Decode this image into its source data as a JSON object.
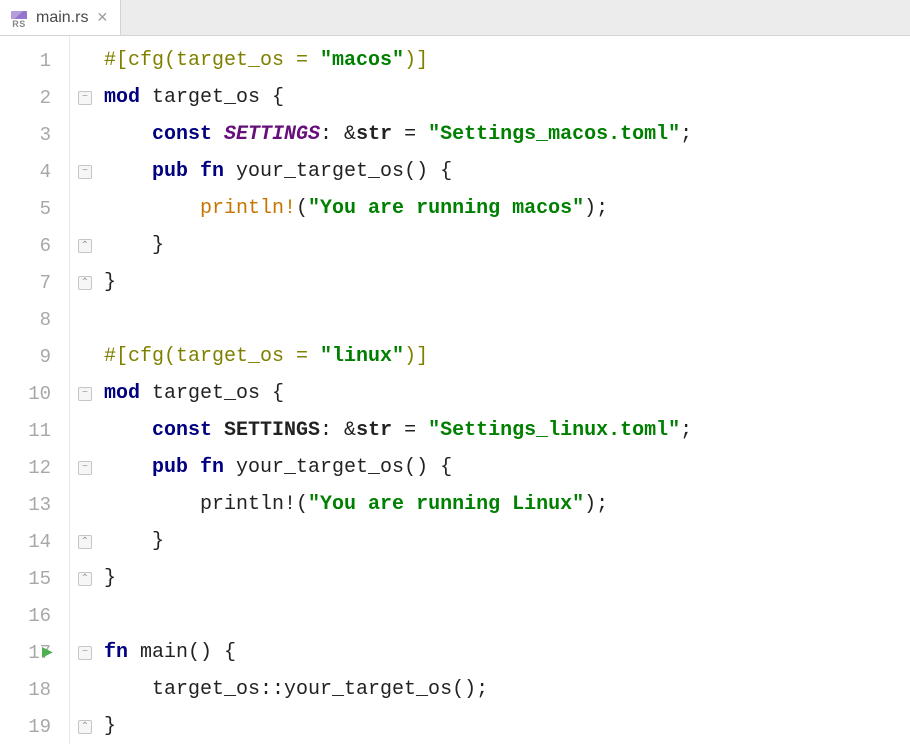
{
  "tab": {
    "filename": "main.rs",
    "icon_text": "RS"
  },
  "gutter": {
    "run_line": 17
  },
  "lines": [
    {
      "n": 1,
      "fold": "",
      "tokens": [
        [
          "attr",
          "#[cfg(target_os = "
        ],
        [
          "str",
          "\"macos\""
        ],
        [
          "attr",
          ")]"
        ]
      ],
      "indent": 0
    },
    {
      "n": 2,
      "fold": "open",
      "tokens": [
        [
          "kw",
          "mod "
        ],
        [
          "ident",
          "target_os "
        ],
        [
          "punct",
          "{"
        ]
      ],
      "indent": 0
    },
    {
      "n": 3,
      "fold": "",
      "tokens": [
        [
          "kw",
          "const "
        ],
        [
          "const_i",
          "SETTINGS"
        ],
        [
          "punct",
          ": &"
        ],
        [
          "type",
          "str"
        ],
        [
          "punct",
          " = "
        ],
        [
          "str",
          "\"Settings_macos.toml\""
        ],
        [
          "punct",
          ";"
        ]
      ],
      "indent": 1
    },
    {
      "n": 4,
      "fold": "open",
      "tokens": [
        [
          "kw",
          "pub fn "
        ],
        [
          "fn",
          "your_target_os"
        ],
        [
          "punct",
          "() {"
        ]
      ],
      "indent": 1
    },
    {
      "n": 5,
      "fold": "",
      "tokens": [
        [
          "macro",
          "println!"
        ],
        [
          "punct",
          "("
        ],
        [
          "str",
          "\"You are running macos\""
        ],
        [
          "punct",
          ");"
        ]
      ],
      "indent": 2
    },
    {
      "n": 6,
      "fold": "close",
      "tokens": [
        [
          "punct",
          "}"
        ]
      ],
      "indent": 1
    },
    {
      "n": 7,
      "fold": "close",
      "tokens": [
        [
          "punct",
          "}"
        ]
      ],
      "indent": 0
    },
    {
      "n": 8,
      "fold": "",
      "tokens": [],
      "indent": 0
    },
    {
      "n": 9,
      "fold": "",
      "tokens": [
        [
          "attr",
          "#[cfg(target_os = "
        ],
        [
          "str",
          "\"linux\""
        ],
        [
          "attr",
          ")]"
        ]
      ],
      "indent": 0
    },
    {
      "n": 10,
      "fold": "open",
      "tokens": [
        [
          "kw",
          "mod "
        ],
        [
          "ident",
          "target_os "
        ],
        [
          "punct",
          "{"
        ]
      ],
      "indent": 0
    },
    {
      "n": 11,
      "fold": "",
      "tokens": [
        [
          "kw",
          "const "
        ],
        [
          "const",
          "SETTINGS"
        ],
        [
          "punct",
          ": &"
        ],
        [
          "type",
          "str"
        ],
        [
          "punct",
          " = "
        ],
        [
          "str",
          "\"Settings_linux.toml\""
        ],
        [
          "punct",
          ";"
        ]
      ],
      "indent": 1
    },
    {
      "n": 12,
      "fold": "open",
      "tokens": [
        [
          "kw",
          "pub fn "
        ],
        [
          "fn",
          "your_target_os"
        ],
        [
          "punct",
          "() {"
        ]
      ],
      "indent": 1
    },
    {
      "n": 13,
      "fold": "",
      "tokens": [
        [
          "ident",
          "println!("
        ],
        [
          "str",
          "\"You are running Linux\""
        ],
        [
          "punct",
          ");"
        ]
      ],
      "indent": 2
    },
    {
      "n": 14,
      "fold": "close",
      "tokens": [
        [
          "punct",
          "}"
        ]
      ],
      "indent": 1
    },
    {
      "n": 15,
      "fold": "close",
      "tokens": [
        [
          "punct",
          "}"
        ]
      ],
      "indent": 0
    },
    {
      "n": 16,
      "fold": "",
      "tokens": [],
      "indent": 0
    },
    {
      "n": 17,
      "fold": "open",
      "tokens": [
        [
          "kw",
          "fn "
        ],
        [
          "fn",
          "main"
        ],
        [
          "punct",
          "() {"
        ]
      ],
      "indent": 0
    },
    {
      "n": 18,
      "fold": "",
      "tokens": [
        [
          "ident",
          "target_os::your_target_os();"
        ]
      ],
      "indent": 1
    },
    {
      "n": 19,
      "fold": "close",
      "tokens": [
        [
          "punct",
          "}"
        ]
      ],
      "indent": 0
    }
  ],
  "cls_map": {
    "attr": "c-attr",
    "kw": "c-kw",
    "str": "c-str",
    "ident": "c-ident",
    "const_i": "c-const-i",
    "const": "c-const",
    "type": "c-type",
    "macro": "c-macro",
    "fn": "c-fn",
    "punct": "c-punct",
    "paren": "c-paren"
  }
}
